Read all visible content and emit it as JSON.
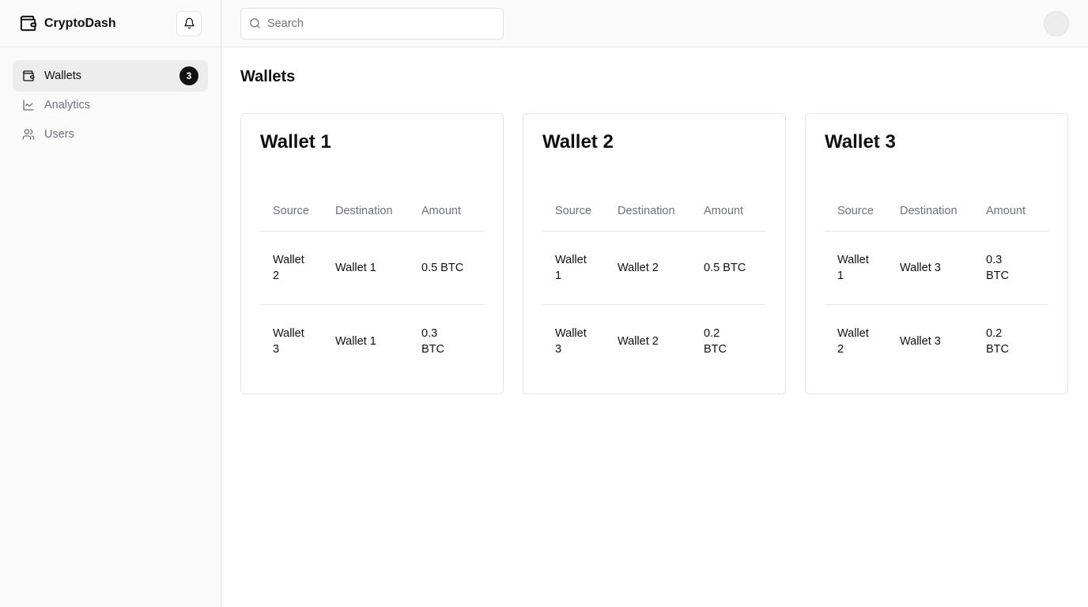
{
  "app": {
    "name": "CryptoDash"
  },
  "sidebar": {
    "items": [
      {
        "label": "Wallets",
        "icon": "wallet-icon",
        "active": true,
        "badge": "3"
      },
      {
        "label": "Analytics",
        "icon": "line-chart-icon",
        "active": false
      },
      {
        "label": "Users",
        "icon": "users-icon",
        "active": false
      }
    ]
  },
  "topbar": {
    "search_placeholder": "Search"
  },
  "page": {
    "title": "Wallets"
  },
  "table_headers": {
    "source": "Source",
    "destination": "Destination",
    "amount": "Amount"
  },
  "wallets": [
    {
      "title": "Wallet 1",
      "rows": [
        {
          "source": "Wallet 2",
          "destination": "Wallet 1",
          "amount": "0.5 BTC"
        },
        {
          "source": "Wallet 3",
          "destination": "Wallet 1",
          "amount": "0.3 BTC"
        }
      ]
    },
    {
      "title": "Wallet 2",
      "rows": [
        {
          "source": "Wallet 1",
          "destination": "Wallet 2",
          "amount": "0.5 BTC"
        },
        {
          "source": "Wallet 3",
          "destination": "Wallet 2",
          "amount": "0.2 BTC"
        }
      ]
    },
    {
      "title": "Wallet 3",
      "rows": [
        {
          "source": "Wallet 1",
          "destination": "Wallet 3",
          "amount": "0.3 BTC"
        },
        {
          "source": "Wallet 2",
          "destination": "Wallet 3",
          "amount": "0.2 BTC"
        }
      ]
    }
  ],
  "colors": {
    "accent": "#111111",
    "muted_text": "#6b7280",
    "border": "#e5e5e5",
    "sidebar_bg": "#fafafa"
  }
}
